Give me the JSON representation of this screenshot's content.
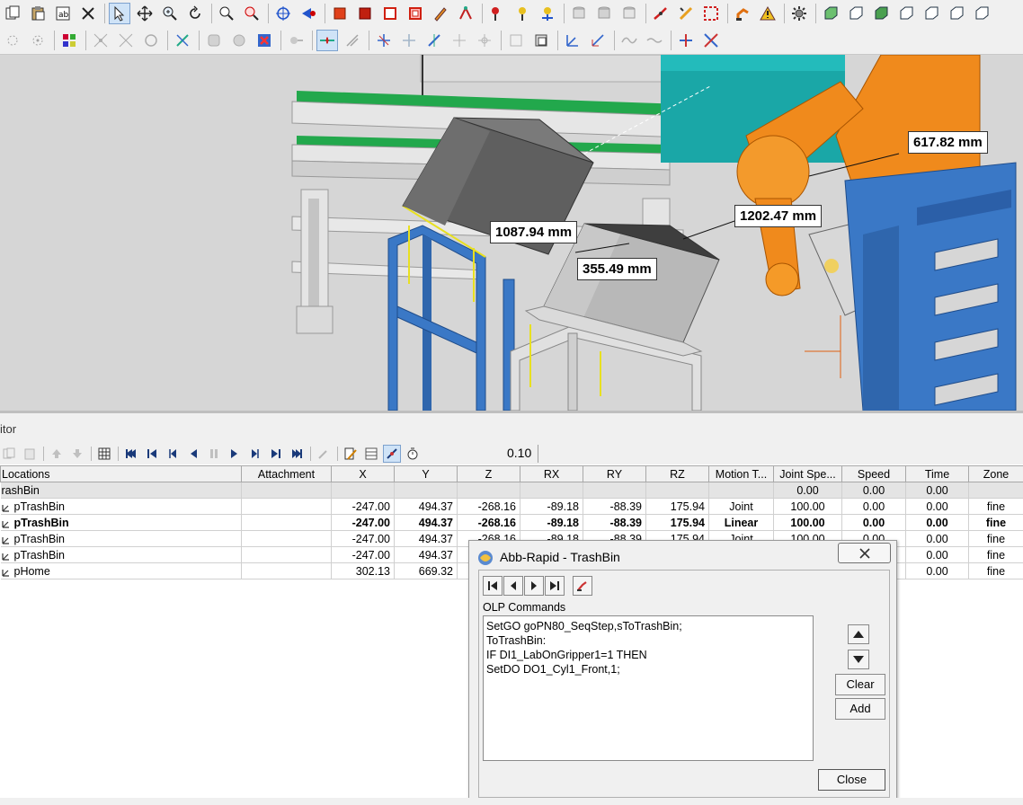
{
  "toolbar": {
    "row1_icons": [
      "copy-icon",
      "paste-icon",
      "properties-icon",
      "cut-icon",
      "select-pointer-icon",
      "move-icon",
      "zoom-icon",
      "rotate-view-icon",
      "zoom-window-icon",
      "zoom-extents-icon",
      "target-icon",
      "aim-icon",
      "red-cube-icon",
      "red-cube-dark-icon",
      "red-box-outline-icon",
      "red-box-split-icon",
      "pencil-tool-icon",
      "path-tool-icon",
      "pin-red-icon",
      "pin-yellow-icon",
      "pin-tool-icon",
      "gray-cylinder-icon",
      "gray-cylinder2-icon",
      "gray-cylinder3-icon",
      "robot-link-icon",
      "measure-tool-icon",
      "frame-tool-icon",
      "robot-arm-icon",
      "robot-warning-icon",
      "gear-tool-icon",
      "green-box-icon",
      "green-box2-icon",
      "green-box3-icon",
      "green-box4-icon",
      "green-box5-icon",
      "green-box6-icon",
      "green-box7-icon"
    ],
    "row2_icons": [
      "snap-icon",
      "snap2-icon",
      "color-tool-icon",
      "scatter-icon",
      "scatter2-icon",
      "circle-tool-icon",
      "axis-tool-icon",
      "gray-tool-icon",
      "gray-tool2-icon",
      "cross-icon",
      "gray-tool3-icon",
      "align-arrow-icon",
      "lines-tool-icon",
      "frame-blue-icon",
      "frame-blue2-icon",
      "frame-blue3-icon",
      "frame-gray-icon",
      "frame-gray2-icon",
      "frame-gray3-icon",
      "frame-gray4-icon",
      "axes-icon",
      "axes2-icon",
      "wave-icon",
      "wave2-icon",
      "split-icon",
      "split2-icon"
    ]
  },
  "viewport": {
    "measurements": [
      "1087.94 mm",
      "355.49 mm",
      "1202.47 mm",
      "617.82 mm"
    ]
  },
  "editor": {
    "panel_title": "itor",
    "speed_value": "0.10"
  },
  "table": {
    "columns": [
      "Locations",
      "Attachment",
      "X",
      "Y",
      "Z",
      "RX",
      "RY",
      "RZ",
      "Motion T...",
      "Joint Spe...",
      "Speed",
      "Time",
      "Zone"
    ],
    "rows": [
      {
        "name": "rashBin",
        "attachment": "",
        "x": "",
        "y": "",
        "z": "",
        "rx": "",
        "ry": "",
        "rz": "",
        "motion": "",
        "joint": "0.00",
        "speed": "0.00",
        "time": "0.00",
        "zone": ""
      },
      {
        "name": "pTrashBin",
        "attachment": "",
        "x": "-247.00",
        "y": "494.37",
        "z": "-268.16",
        "rx": "-89.18",
        "ry": "-88.39",
        "rz": "175.94",
        "motion": "Joint",
        "joint": "100.00",
        "speed": "0.00",
        "time": "0.00",
        "zone": "fine"
      },
      {
        "name": "pTrashBin",
        "attachment": "",
        "x": "-247.00",
        "y": "494.37",
        "z": "-268.16",
        "rx": "-89.18",
        "ry": "-88.39",
        "rz": "175.94",
        "motion": "Linear",
        "joint": "100.00",
        "speed": "0.00",
        "time": "0.00",
        "zone": "fine"
      },
      {
        "name": "pTrashBin",
        "attachment": "",
        "x": "-247.00",
        "y": "494.37",
        "z": "-268.16",
        "rx": "-89.18",
        "ry": "-88.39",
        "rz": "175.94",
        "motion": "Joint",
        "joint": "100.00",
        "speed": "0.00",
        "time": "0.00",
        "zone": "fine"
      },
      {
        "name": "pTrashBin",
        "attachment": "",
        "x": "-247.00",
        "y": "494.37",
        "z": "",
        "rx": "",
        "ry": "",
        "rz": "",
        "motion": "",
        "joint": "",
        "speed": "",
        "time": "0.00",
        "zone": "fine"
      },
      {
        "name": "pHome",
        "attachment": "",
        "x": "302.13",
        "y": "669.32",
        "z": "",
        "rx": "",
        "ry": "",
        "rz": "",
        "motion": "",
        "joint": "",
        "speed": "",
        "time": "0.00",
        "zone": "fine"
      }
    ]
  },
  "dialog": {
    "title": "Abb-Rapid - TrashBin",
    "olp_label": "OLP Commands",
    "olp_lines": [
      "SetGO goPN80_SeqStep,sToTrashBin;",
      "ToTrashBin:",
      "IF DI1_LabOnGripper1=1 THEN",
      "SetDO DO1_Cyl1_Front,1;"
    ],
    "clear_label": "Clear",
    "add_label": "Add",
    "close_label": "Close"
  },
  "colors": {
    "robot_orange": "#f08a1c",
    "frame_blue": "#3a78c6",
    "box_dark": "#6a6a6a",
    "box_light": "#bdbdbd",
    "conveyor_green": "#1fa84a"
  }
}
